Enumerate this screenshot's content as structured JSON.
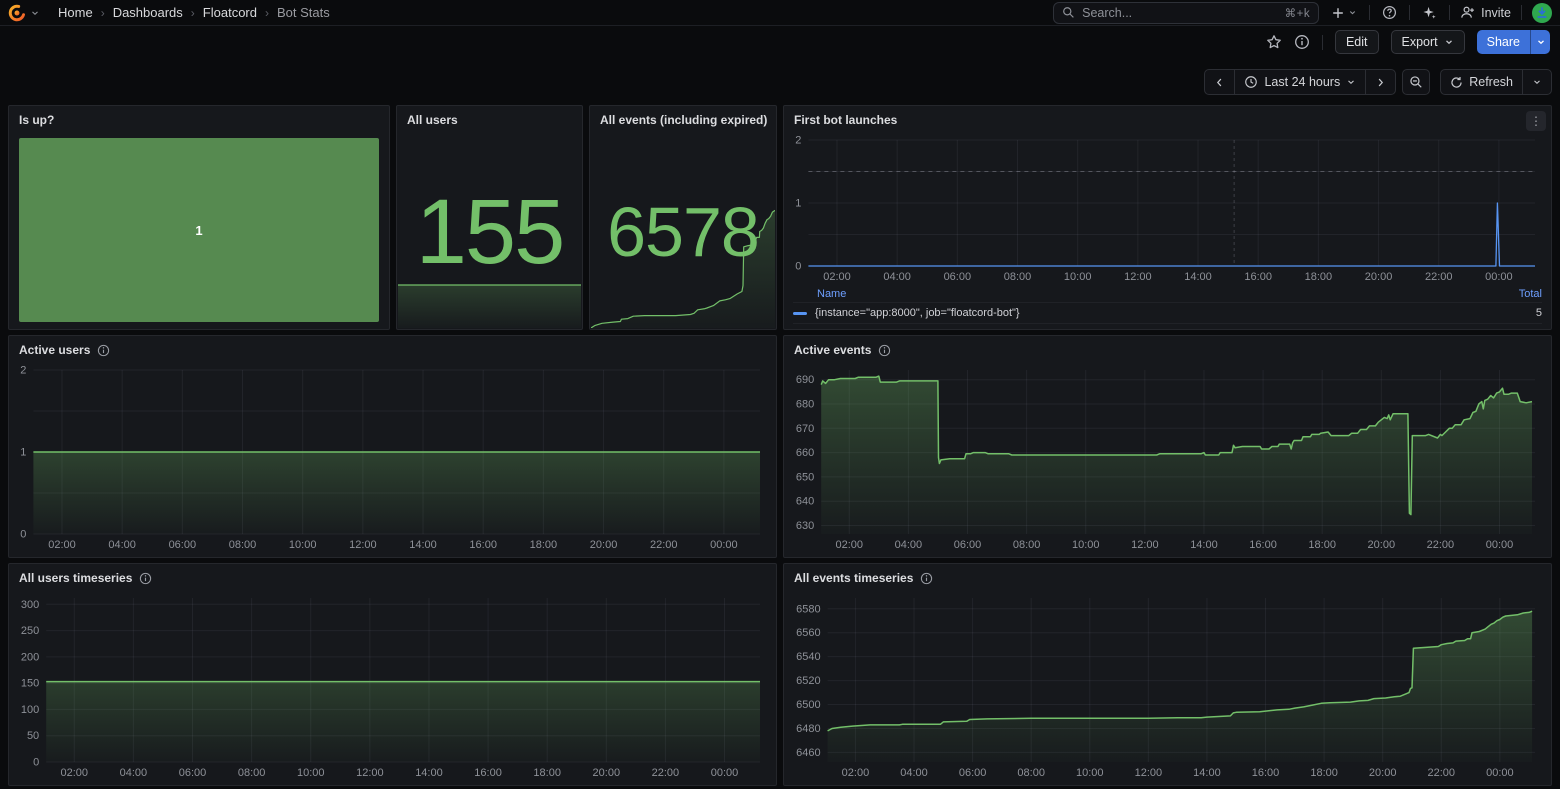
{
  "nav": {
    "breadcrumb": {
      "home": "Home",
      "dashboards": "Dashboards",
      "folder": "Floatcord",
      "page": "Bot Stats"
    },
    "search": {
      "placeholder": "Search...",
      "shortcut": "⌘+k"
    },
    "invite_label": "Invite"
  },
  "toolbar": {
    "edit": "Edit",
    "export": "Export",
    "share": "Share"
  },
  "timebar": {
    "range": "Last 24 hours",
    "refresh": "Refresh"
  },
  "panels": {
    "is_up": {
      "title": "Is up?",
      "value": "1"
    },
    "all_users": {
      "title": "All users",
      "value": "155"
    },
    "all_events": {
      "title": "All events (including expired)",
      "value": "6578"
    },
    "first_bot": {
      "title": "First bot launches",
      "legend": {
        "name_header": "Name",
        "total_header": "Total",
        "series": "{instance=\"app:8000\", job=\"floatcord-bot\"}",
        "total": "5"
      }
    },
    "active_users": {
      "title": "Active users"
    },
    "active_events": {
      "title": "Active events"
    },
    "all_users_ts": {
      "title": "All users timeseries"
    },
    "all_events_ts": {
      "title": "All events timeseries"
    }
  },
  "colors": {
    "stat_green": "#73BF69",
    "isup_green": "#568A50",
    "series_green": "#73BF69",
    "series_blue": "#5794F2",
    "legend_header_blue": "#6E9FFF",
    "share_blue": "#3D71D9"
  },
  "chart_shared": {
    "hours": [
      [
        2,
        "02:00"
      ],
      [
        4,
        "04:00"
      ],
      [
        6,
        "06:00"
      ],
      [
        8,
        "08:00"
      ],
      [
        10,
        "10:00"
      ],
      [
        12,
        "12:00"
      ],
      [
        14,
        "14:00"
      ],
      [
        16,
        "16:00"
      ],
      [
        18,
        "18:00"
      ],
      [
        20,
        "20:00"
      ],
      [
        22,
        "22:00"
      ],
      [
        24,
        "00:00"
      ]
    ]
  },
  "chart_data": [
    {
      "id": "first-bot",
      "type": "line",
      "title": "First bot launches",
      "color": "#5794F2",
      "fill": false,
      "stroke": 1.3,
      "xlim": [
        1.05,
        25.2
      ],
      "x_ticks": "hours",
      "ylim": [
        0,
        2
      ],
      "y_ticks": [
        0,
        1,
        2
      ],
      "y_grid_step": 0.5,
      "threshold_y": 1.5,
      "annotation_x": 15.2,
      "points": [
        [
          1.05,
          0
        ],
        [
          23.9,
          0
        ],
        [
          23.95,
          1
        ],
        [
          24.02,
          0
        ],
        [
          25.2,
          0
        ]
      ]
    },
    {
      "id": "active-users",
      "type": "line",
      "title": "Active users",
      "color": "#73BF69",
      "fill": true,
      "fill_opacity": 0.25,
      "stroke": 1.5,
      "xlim": [
        1.05,
        25.2
      ],
      "x_ticks": "hours",
      "ylim": [
        0,
        2
      ],
      "y_ticks": [
        0,
        1,
        2
      ],
      "y_grid_step": 0.5,
      "points": [
        [
          1.05,
          1
        ],
        [
          25.2,
          1
        ]
      ]
    },
    {
      "id": "active-events",
      "type": "line",
      "title": "Active events",
      "color": "#73BF69",
      "fill": true,
      "fill_opacity": 0.3,
      "stroke": 1.5,
      "xlim": [
        1.05,
        25.2
      ],
      "x_ticks": "hours",
      "ylim": [
        626.5,
        694
      ],
      "y_ticks": [
        630,
        640,
        650,
        660,
        670,
        680,
        690
      ],
      "y_grid_step": 10,
      "points": [
        [
          1.05,
          688
        ],
        [
          1.1,
          689.5
        ],
        [
          1.2,
          688.5
        ],
        [
          1.3,
          690
        ],
        [
          1.5,
          690
        ],
        [
          1.7,
          690.5
        ],
        [
          2.2,
          690.5
        ],
        [
          2.3,
          691
        ],
        [
          2.9,
          691
        ],
        [
          3.0,
          691.5
        ],
        [
          3.05,
          689
        ],
        [
          3.6,
          689
        ],
        [
          3.7,
          689.5
        ],
        [
          5.0,
          689.5
        ],
        [
          5.02,
          658
        ],
        [
          5.05,
          655.5
        ],
        [
          5.1,
          657
        ],
        [
          5.4,
          657.5
        ],
        [
          5.9,
          657.5
        ],
        [
          5.95,
          659.5
        ],
        [
          6.1,
          659.5
        ],
        [
          6.2,
          660
        ],
        [
          6.6,
          660
        ],
        [
          6.7,
          659.5
        ],
        [
          7.4,
          659.5
        ],
        [
          7.5,
          659
        ],
        [
          12.4,
          659
        ],
        [
          12.5,
          659.5
        ],
        [
          13.9,
          659.5
        ],
        [
          14.0,
          660
        ],
        [
          14.05,
          659
        ],
        [
          14.5,
          659
        ],
        [
          14.55,
          660
        ],
        [
          14.95,
          660
        ],
        [
          15.0,
          663
        ],
        [
          15.05,
          662
        ],
        [
          15.3,
          662.5
        ],
        [
          15.9,
          662.5
        ],
        [
          15.95,
          661.5
        ],
        [
          16.2,
          661.5
        ],
        [
          16.3,
          662.5
        ],
        [
          16.5,
          662.5
        ],
        [
          16.55,
          663.5
        ],
        [
          16.9,
          663.5
        ],
        [
          16.95,
          661.5
        ],
        [
          17.0,
          664
        ],
        [
          17.05,
          665
        ],
        [
          17.3,
          665
        ],
        [
          17.35,
          666.5
        ],
        [
          17.6,
          666.5
        ],
        [
          17.65,
          667.5
        ],
        [
          17.9,
          667.5
        ],
        [
          17.95,
          668
        ],
        [
          18.2,
          668.5
        ],
        [
          18.3,
          667
        ],
        [
          18.9,
          667
        ],
        [
          19.0,
          668
        ],
        [
          19.2,
          668
        ],
        [
          19.3,
          669.5
        ],
        [
          19.5,
          669.5
        ],
        [
          19.6,
          671
        ],
        [
          19.8,
          671
        ],
        [
          19.9,
          672.5
        ],
        [
          20.0,
          673.5
        ],
        [
          20.1,
          674.5
        ],
        [
          20.2,
          674
        ],
        [
          20.25,
          675.5
        ],
        [
          20.3,
          673.5
        ],
        [
          20.4,
          676
        ],
        [
          20.9,
          676
        ],
        [
          20.95,
          635
        ],
        [
          21.0,
          634.5
        ],
        [
          21.05,
          667
        ],
        [
          21.5,
          667
        ],
        [
          21.6,
          667.5
        ],
        [
          21.9,
          666
        ],
        [
          22.0,
          667.5
        ],
        [
          22.05,
          667
        ],
        [
          22.3,
          670
        ],
        [
          22.4,
          670
        ],
        [
          22.5,
          671.5
        ],
        [
          22.7,
          671.5
        ],
        [
          22.8,
          673.5
        ],
        [
          23.0,
          674
        ],
        [
          23.1,
          676.5
        ],
        [
          23.2,
          677
        ],
        [
          23.3,
          680
        ],
        [
          23.4,
          681
        ],
        [
          23.45,
          678
        ],
        [
          23.5,
          681.5
        ],
        [
          23.6,
          682
        ],
        [
          23.7,
          683.5
        ],
        [
          23.8,
          682.5
        ],
        [
          23.9,
          684.5
        ],
        [
          24.0,
          685
        ],
        [
          24.1,
          686.5
        ],
        [
          24.15,
          684
        ],
        [
          24.3,
          684
        ],
        [
          24.4,
          684.5
        ],
        [
          24.6,
          684.5
        ],
        [
          24.7,
          681
        ],
        [
          24.9,
          680.5
        ],
        [
          25.1,
          681
        ]
      ]
    },
    {
      "id": "all-users-ts",
      "type": "line",
      "title": "All users timeseries",
      "color": "#73BF69",
      "fill": true,
      "fill_opacity": 0.22,
      "stroke": 1.5,
      "xlim": [
        1.05,
        25.2
      ],
      "x_ticks": "hours",
      "ylim": [
        0,
        312
      ],
      "y_ticks": [
        0,
        50,
        100,
        150,
        200,
        250,
        300
      ],
      "y_grid_step": 50,
      "points": [
        [
          1.05,
          153
        ],
        [
          25.2,
          153
        ]
      ]
    },
    {
      "id": "all-events-ts",
      "type": "line",
      "title": "All events timeseries",
      "color": "#73BF69",
      "fill": true,
      "fill_opacity": 0.3,
      "stroke": 1.5,
      "xlim": [
        1.05,
        25.2
      ],
      "x_ticks": "hours",
      "ylim": [
        6452,
        6589
      ],
      "y_ticks": [
        6460,
        6480,
        6500,
        6520,
        6540,
        6560,
        6580
      ],
      "y_grid_step": 20,
      "points": [
        [
          1.05,
          6478
        ],
        [
          1.2,
          6480
        ],
        [
          1.5,
          6481
        ],
        [
          1.9,
          6482
        ],
        [
          2.2,
          6482.5
        ],
        [
          2.5,
          6483
        ],
        [
          3.5,
          6483
        ],
        [
          3.6,
          6483.5
        ],
        [
          4.9,
          6483.5
        ],
        [
          5.0,
          6485.5
        ],
        [
          5.8,
          6486
        ],
        [
          5.9,
          6487.5
        ],
        [
          6.5,
          6488
        ],
        [
          8.0,
          6488.5
        ],
        [
          12.0,
          6488.5
        ],
        [
          13.0,
          6489
        ],
        [
          13.8,
          6489
        ],
        [
          14.0,
          6489.5
        ],
        [
          14.4,
          6490
        ],
        [
          14.8,
          6490.5
        ],
        [
          14.9,
          6493
        ],
        [
          15.0,
          6493.5
        ],
        [
          15.8,
          6494
        ],
        [
          16.0,
          6494.5
        ],
        [
          16.4,
          6495.5
        ],
        [
          16.8,
          6496
        ],
        [
          17.0,
          6497
        ],
        [
          17.3,
          6498
        ],
        [
          17.6,
          6499.5
        ],
        [
          17.9,
          6501
        ],
        [
          18.2,
          6501.5
        ],
        [
          18.9,
          6502
        ],
        [
          19.2,
          6503
        ],
        [
          19.5,
          6503.5
        ],
        [
          19.7,
          6505
        ],
        [
          20.1,
          6505.5
        ],
        [
          20.4,
          6506.5
        ],
        [
          20.6,
          6507
        ],
        [
          20.8,
          6509
        ],
        [
          20.9,
          6510
        ],
        [
          20.95,
          6513.5
        ],
        [
          21.0,
          6514
        ],
        [
          21.05,
          6547
        ],
        [
          21.6,
          6548
        ],
        [
          21.9,
          6548.5
        ],
        [
          22.0,
          6550
        ],
        [
          22.2,
          6551
        ],
        [
          22.4,
          6551.5
        ],
        [
          22.5,
          6553
        ],
        [
          22.8,
          6553.5
        ],
        [
          22.9,
          6555
        ],
        [
          23.0,
          6555
        ],
        [
          23.05,
          6560
        ],
        [
          23.3,
          6561
        ],
        [
          23.5,
          6563
        ],
        [
          23.6,
          6565
        ],
        [
          23.7,
          6567
        ],
        [
          23.8,
          6568
        ],
        [
          23.9,
          6570
        ],
        [
          24.0,
          6571
        ],
        [
          24.1,
          6573
        ],
        [
          24.2,
          6574
        ],
        [
          24.4,
          6574.5
        ],
        [
          24.6,
          6575
        ],
        [
          24.8,
          6576.5
        ],
        [
          25.0,
          6577
        ],
        [
          25.1,
          6578
        ]
      ]
    },
    {
      "id": "spark-users",
      "type": "sparkline",
      "title": "All users sparkline",
      "color": "#73BF69",
      "fill": true,
      "fill_opacity": 0.22,
      "stroke": 1.2,
      "xlim": [
        0,
        1
      ],
      "ylim": [
        0,
        1
      ],
      "points": [
        [
          0,
          1
        ],
        [
          1,
          1
        ]
      ]
    },
    {
      "id": "spark-events",
      "type": "sparkline",
      "title": "All events sparkline",
      "color": "#73BF69",
      "fill": true,
      "fill_opacity": 0.22,
      "stroke": 1.2,
      "xlim": [
        0,
        1
      ],
      "ylim": [
        0,
        1.02
      ],
      "points": [
        [
          0,
          0
        ],
        [
          0.02,
          0.02
        ],
        [
          0.06,
          0.04
        ],
        [
          0.12,
          0.05
        ],
        [
          0.16,
          0.055
        ],
        [
          0.165,
          0.075
        ],
        [
          0.2,
          0.08
        ],
        [
          0.23,
          0.1
        ],
        [
          0.29,
          0.105
        ],
        [
          0.46,
          0.105
        ],
        [
          0.54,
          0.115
        ],
        [
          0.56,
          0.125
        ],
        [
          0.58,
          0.155
        ],
        [
          0.62,
          0.165
        ],
        [
          0.63,
          0.17
        ],
        [
          0.665,
          0.19
        ],
        [
          0.7,
          0.23
        ],
        [
          0.73,
          0.24
        ],
        [
          0.755,
          0.25
        ],
        [
          0.775,
          0.27
        ],
        [
          0.795,
          0.29
        ],
        [
          0.82,
          0.31
        ],
        [
          0.826,
          0.36
        ],
        [
          0.83,
          0.69
        ],
        [
          0.855,
          0.7
        ],
        [
          0.87,
          0.705
        ],
        [
          0.875,
          0.72
        ],
        [
          0.885,
          0.73
        ],
        [
          0.895,
          0.75
        ],
        [
          0.9,
          0.77
        ],
        [
          0.915,
          0.77
        ],
        [
          0.917,
          0.82
        ],
        [
          0.927,
          0.83
        ],
        [
          0.937,
          0.85
        ],
        [
          0.946,
          0.89
        ],
        [
          0.956,
          0.92
        ],
        [
          0.966,
          0.93
        ],
        [
          0.976,
          0.95
        ],
        [
          0.986,
          0.985
        ],
        [
          1,
          1
        ]
      ]
    }
  ]
}
